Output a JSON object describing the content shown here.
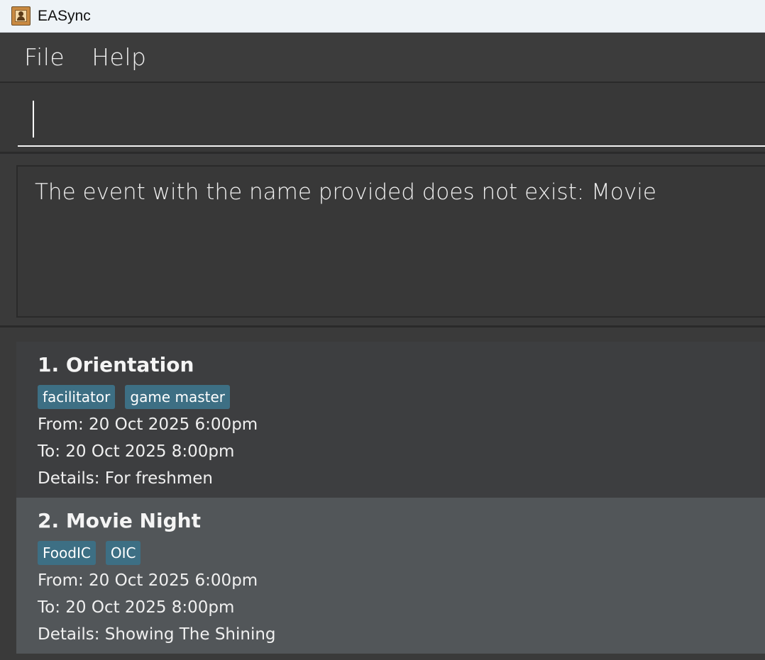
{
  "window": {
    "title": "EASync",
    "icon": "address-book-icon"
  },
  "menu": {
    "items": [
      {
        "label": "File"
      },
      {
        "label": "Help"
      }
    ]
  },
  "command": {
    "value": "",
    "placeholder": ""
  },
  "result": {
    "message": "The event with the name provided does not exist: Movie"
  },
  "events": [
    {
      "title": "1. Orientation",
      "tags": [
        "facilitator",
        "game master"
      ],
      "from": "From: 20 Oct 2025 6:00pm",
      "to": "To: 20 Oct 2025 8:00pm",
      "details": "Details: For freshmen"
    },
    {
      "title": "2. Movie Night",
      "tags": [
        "FoodIC",
        "OIC"
      ],
      "from": "From: 20 Oct 2025 6:00pm",
      "to": "To: 20 Oct 2025 8:00pm",
      "details": "Details: Showing The Shining"
    }
  ],
  "colors": {
    "tag_background": "#3d6f84",
    "card_background": "#3d3e40",
    "card_selected_background": "#525659",
    "app_background": "#3a3a3a"
  }
}
